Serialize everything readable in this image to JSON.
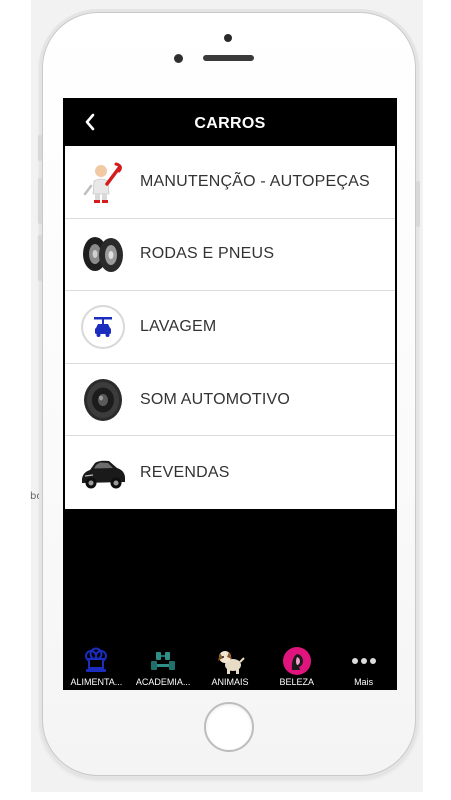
{
  "stray_text": "bo",
  "header": {
    "title": "CARROS",
    "back_icon": "chevron-left-icon"
  },
  "list": {
    "items": [
      {
        "label": "MANUTENÇÃO - AUTOPEÇAS",
        "icon": "mechanic-wrench-icon"
      },
      {
        "label": "RODAS E PNEUS",
        "icon": "tires-icon"
      },
      {
        "label": "LAVAGEM",
        "icon": "car-wash-icon"
      },
      {
        "label": "SOM AUTOMOTIVO",
        "icon": "speaker-icon"
      },
      {
        "label": "REVENDAS",
        "icon": "car-icon"
      }
    ]
  },
  "tabbar": {
    "tabs": [
      {
        "label": "ALIMENTA...",
        "icon": "chef-hat-icon"
      },
      {
        "label": "ACADEMIA...",
        "icon": "dumbbell-icon"
      },
      {
        "label": "ANIMAIS",
        "icon": "dog-icon"
      },
      {
        "label": "BELEZA",
        "icon": "beauty-icon"
      },
      {
        "label": "Mais",
        "icon": "more-dots-icon"
      }
    ]
  },
  "colors": {
    "screen_bg": "#000000",
    "list_bg": "#ffffff",
    "label_text": "#333333",
    "accent_blue": "#1a2dbf",
    "accent_pink": "#e0147d"
  }
}
